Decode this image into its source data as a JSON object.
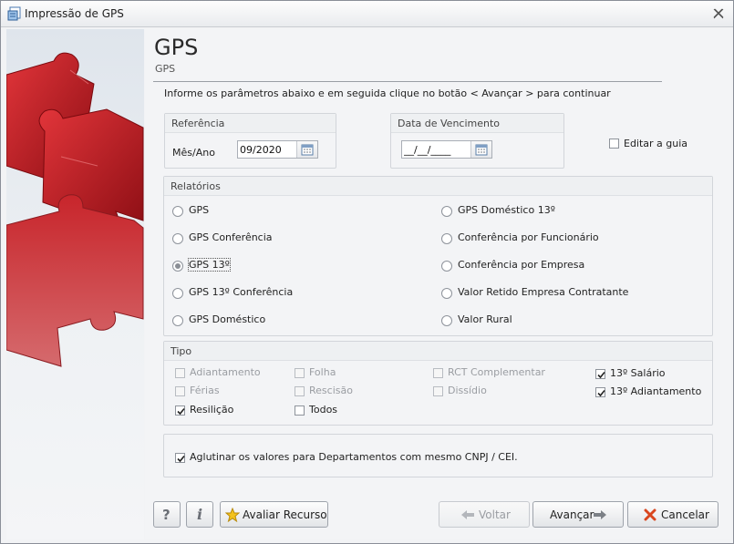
{
  "window": {
    "title": "Impressão de GPS"
  },
  "header": {
    "title": "GPS",
    "subtitle": "GPS",
    "instruction": "Informe os parâmetros abaixo e em seguida clique no botão < Avançar > para continuar"
  },
  "referencia": {
    "title": "Referência",
    "label": "Mês/Ano",
    "value": "09/2020"
  },
  "vencimento": {
    "title": "Data de Vencimento",
    "value": "__/__/____"
  },
  "editar_guia": {
    "label": "Editar a guia",
    "checked": false
  },
  "relatorios": {
    "title": "Relatórios",
    "selected": "GPS 13º",
    "left": [
      "GPS",
      "GPS Conferência",
      "GPS 13º",
      "GPS 13º Conferência",
      "GPS Doméstico"
    ],
    "right": [
      "GPS Doméstico 13º",
      "Conferência por Funcionário",
      "Conferência por Empresa",
      "Valor Retido Empresa Contratante",
      "Valor Rural"
    ]
  },
  "tipo": {
    "title": "Tipo",
    "items": [
      {
        "label": "Adiantamento",
        "checked": false,
        "enabled": false
      },
      {
        "label": "Folha",
        "checked": false,
        "enabled": false
      },
      {
        "label": "RCT Complementar",
        "checked": false,
        "enabled": false
      },
      {
        "label": "13º Salário",
        "checked": true,
        "enabled": true
      },
      {
        "label": "Férias",
        "checked": false,
        "enabled": false
      },
      {
        "label": "Rescisão",
        "checked": false,
        "enabled": false
      },
      {
        "label": "Dissídio",
        "checked": false,
        "enabled": false
      },
      {
        "label": "13º Adiantamento",
        "checked": true,
        "enabled": true
      },
      {
        "label": "Resilição",
        "checked": true,
        "enabled": true
      },
      {
        "label": "Todos",
        "checked": false,
        "enabled": true
      }
    ]
  },
  "aglutinar": {
    "label": "Aglutinar os valores para Departamentos com mesmo CNPJ / CEI.",
    "checked": true
  },
  "buttons": {
    "help": "?",
    "info": "i",
    "avaliar": "Avaliar Recurso",
    "voltar": "Voltar",
    "avancar": "Avançar",
    "cancelar": "Cancelar"
  },
  "colors": {
    "puzzle_red": "#c0141c",
    "accent_green": "#2e8b3a",
    "cancel_red": "#d9461e"
  }
}
